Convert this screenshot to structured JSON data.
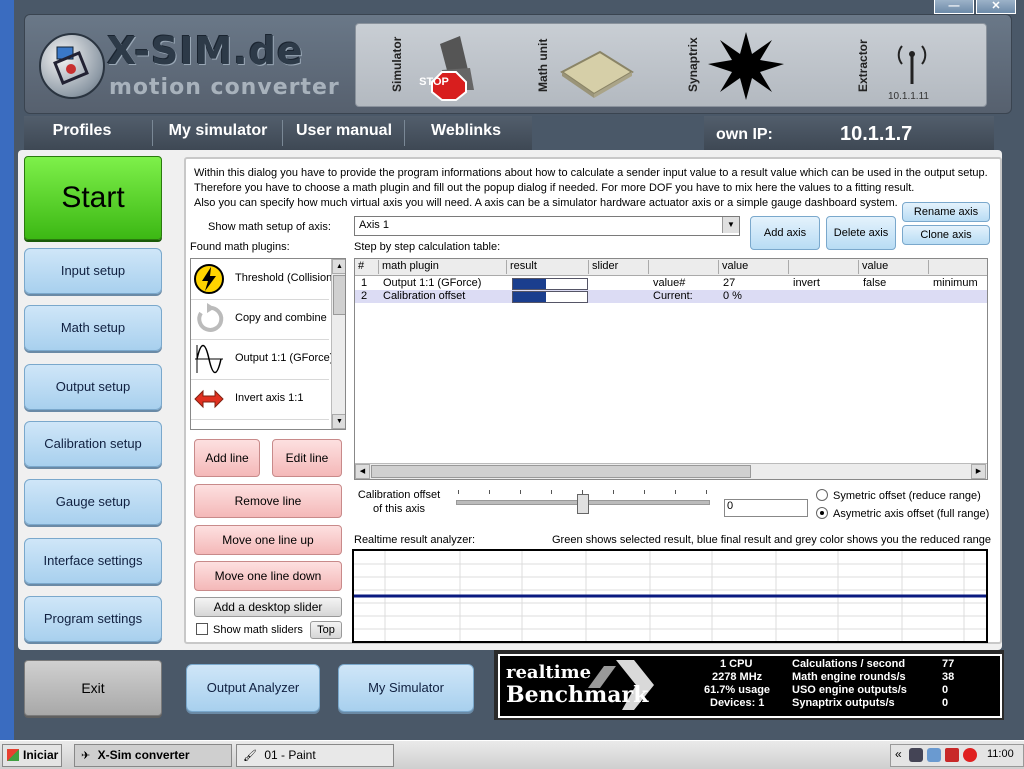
{
  "window": {
    "minimize_label": "—",
    "close_label": "✕"
  },
  "header": {
    "logo_title": "X-SIM.de",
    "logo_subtitle": "motion converter",
    "devices": {
      "simulator": "Simulator",
      "math_unit": "Math unit",
      "synaptrix": "Synaptrix",
      "extractor": "Extractor",
      "extractor_ip": "10.1.1.11",
      "stop_label": "STOP"
    }
  },
  "nav": {
    "items": [
      {
        "label": "Profiles"
      },
      {
        "label": "My simulator"
      },
      {
        "label": "User manual"
      },
      {
        "label": "Weblinks"
      }
    ],
    "own_ip_label": "own IP:",
    "own_ip_value": "10.1.1.7"
  },
  "sidebar": {
    "start_label": "Start",
    "items": [
      {
        "label": "Input setup"
      },
      {
        "label": "Math setup"
      },
      {
        "label": "Output setup"
      },
      {
        "label": "Calibration setup"
      },
      {
        "label": "Gauge setup"
      },
      {
        "label": "Interface settings"
      },
      {
        "label": "Program settings"
      }
    ],
    "exit_label": "Exit"
  },
  "math": {
    "intro_lines": [
      "Within this dialog you have to provide the program informations about how to calculate a sender input value to a result value which can be used in the output setup.",
      "Therefore you have to choose a math plugin and fill out the popup dialog if needed. For more DOF you have to mix here the values to a fitting result.",
      "Also you can specify how much virtual axis you will need. A axis can be a simulator hardware actuator axis or a simple gauge dashboard system."
    ],
    "axis_label": "Show math setup of axis:",
    "axis_value": "Axis 1",
    "add_axis": "Add axis",
    "delete_axis": "Delete axis",
    "rename_axis": "Rename axis",
    "clone_axis": "Clone axis",
    "plugins_label": "Found math plugins:",
    "plugins": [
      {
        "label": "Threshold (Collision)",
        "icon": "lightning-icon"
      },
      {
        "label": "Copy and combine",
        "icon": "copy-cycle-icon"
      },
      {
        "label": "Output 1:1 (GForce)",
        "icon": "sine-wave-icon"
      },
      {
        "label": "Invert axis 1:1",
        "icon": "invert-arrows-icon"
      }
    ],
    "table_label": "Step by step calculation table:",
    "table_headers": [
      "#",
      "math plugin",
      "result",
      "slider",
      "",
      "value",
      "",
      "value",
      ""
    ],
    "rows": [
      {
        "num": "1",
        "plugin": "Output 1:1 (GForce)",
        "result_fraction": 0.45,
        "c4": "value#",
        "c5": "27",
        "c6": "invert",
        "c7": "false",
        "c8": "minimum"
      },
      {
        "num": "2",
        "plugin": "Calibration offset",
        "result_fraction": 0.45,
        "c4": "Current:",
        "c5": "0 %",
        "c6": "",
        "c7": "",
        "c8": ""
      }
    ],
    "add_line": "Add line",
    "edit_line": "Edit line",
    "remove_line": "Remove line",
    "move_up": "Move one line up",
    "move_down": "Move one line down",
    "add_slider": "Add a desktop slider",
    "show_sliders": "Show math sliders",
    "top_label": "Top",
    "cal_label_1": "Calibration offset",
    "cal_label_2": "of this axis",
    "cal_value": "0",
    "slider_fraction": 0.5,
    "radio_sym": "Symetric offset (reduce range)",
    "radio_asym": "Asymetric axis offset (full range)",
    "analyzer_label": "Realtime result analyzer:",
    "analyzer_note": "Green shows selected result, blue final result and grey color shows you the reduced range"
  },
  "bottom": {
    "output_analyzer": "Output Analyzer",
    "my_simulator": "My Simulator"
  },
  "benchmark": {
    "logo_top": "realtime",
    "logo_bottom": "Benchmark",
    "cpu": "1 CPU",
    "mhz": "2278 MHz",
    "usage": "61.7% usage",
    "devices": "Devices: 1",
    "calc_label": "Calculations / second",
    "calc_value": "77",
    "rounds_label": "Math engine rounds/s",
    "rounds_value": "38",
    "uso_label": "USO engine outputs/s",
    "uso_value": "0",
    "syn_label": "Synaptrix outputs/s",
    "syn_value": "0"
  },
  "taskbar": {
    "start": "Iniciar",
    "task1": "X-Sim converter",
    "task2": "01 - Paint",
    "clock": "11:00"
  },
  "colors": {
    "start_green": "#3cb814",
    "result_bar": "#1a3e8e"
  }
}
